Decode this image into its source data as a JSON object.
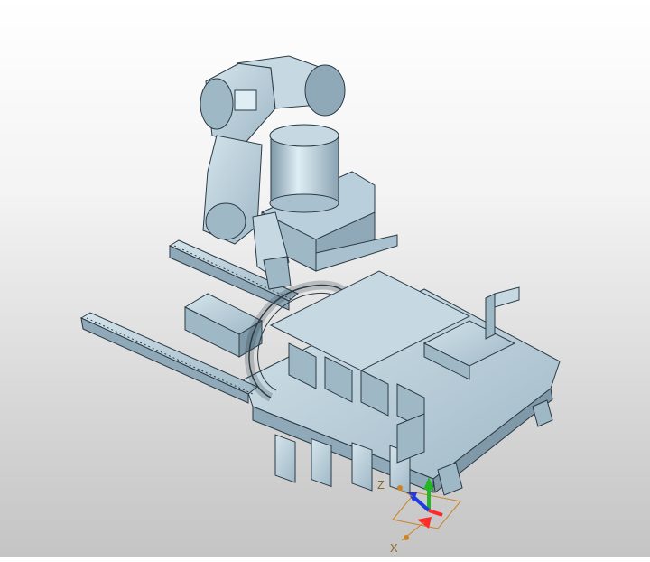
{
  "viewport": {
    "background_top": "#ffffff",
    "background_bottom": "#c4c4c4",
    "model_color": "#b7cfdc",
    "model_shade": "#8fa9b8",
    "edge_color": "#2b3a44"
  },
  "triad": {
    "z_label": "Z",
    "x_label": "X",
    "x_color": "#ff2a2a",
    "y_color": "#26b526",
    "z_color": "#1f3be0",
    "handle_color": "#c8842a"
  }
}
